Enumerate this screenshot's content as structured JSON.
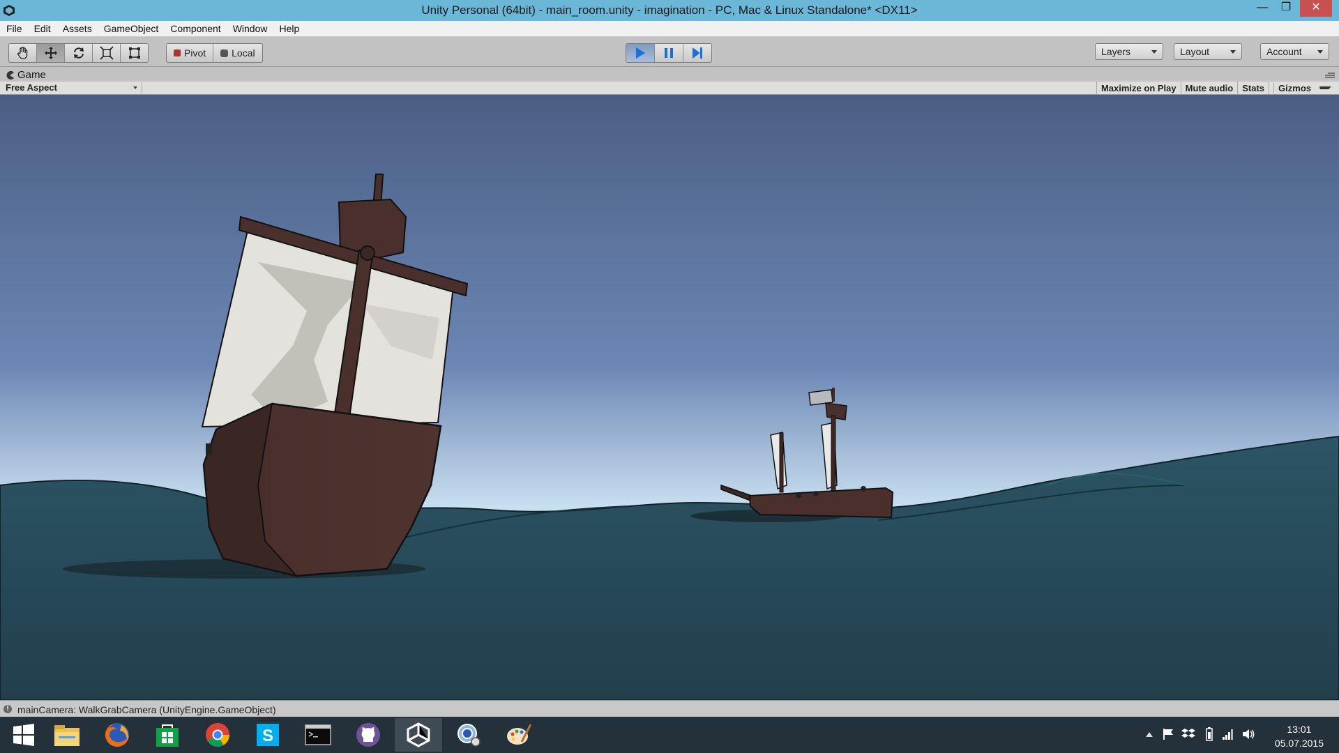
{
  "window": {
    "title": "Unity Personal (64bit) - main_room.unity - imagination - PC, Mac & Linux Standalone* <DX11>",
    "minimize_icon": "minimize-icon",
    "restore_icon": "restore-icon",
    "close_icon": "close-icon"
  },
  "menu": [
    "File",
    "Edit",
    "Assets",
    "GameObject",
    "Component",
    "Window",
    "Help"
  ],
  "toolbar": {
    "transform_tools": [
      "hand-icon",
      "move-icon",
      "rotate-icon",
      "scale-icon",
      "rect-tool-icon"
    ],
    "pivot_label": "Pivot",
    "local_label": "Local",
    "play_icon": "play-icon",
    "pause_icon": "pause-icon",
    "step_icon": "step-icon",
    "layers_label": "Layers",
    "layout_label": "Layout",
    "account_label": "Account"
  },
  "game_panel": {
    "tab_label": "Game",
    "aspect_label": "Free Aspect",
    "options": [
      "Maximize on Play",
      "Mute audio",
      "Stats",
      "Gizmos"
    ]
  },
  "status": {
    "message": "mainCamera: WalkGrabCamera (UnityEngine.GameObject)"
  },
  "taskbar": {
    "apps": [
      "windows-start-icon",
      "file-explorer-icon",
      "firefox-icon",
      "store-icon",
      "chrome-icon",
      "skype-icon",
      "command-prompt-icon",
      "github-icon",
      "unity-icon",
      "remote-desktop-icon",
      "paint-icon"
    ],
    "time": "13:01",
    "date": "05.07.2015"
  },
  "colors": {
    "titlebar": "#6ab7d8",
    "sky_top": "#4a5f85",
    "sky_horizon": "#c8dff0",
    "sea": "#274a58",
    "hull": "#4a302c",
    "sail": "#e4e2dc"
  }
}
